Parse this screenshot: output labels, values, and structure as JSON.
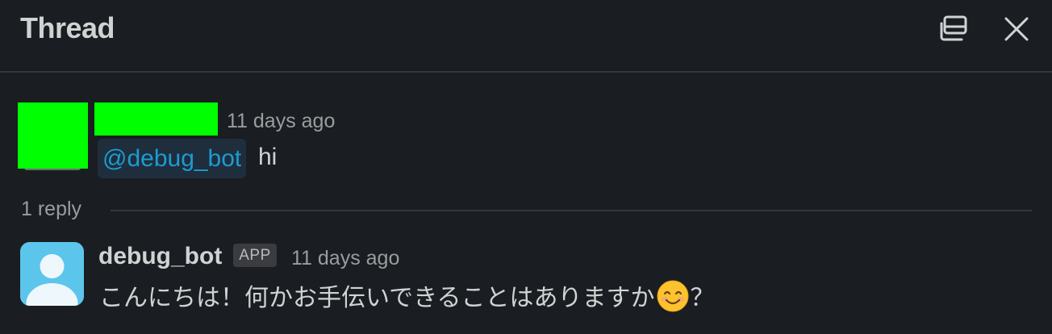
{
  "header": {
    "title": "Thread",
    "popout_icon": "popout-window-icon",
    "close_icon": "close-icon"
  },
  "parent_message": {
    "avatar": "redacted",
    "sender": "",
    "timestamp": "11 days ago",
    "mention": "@debug_bot",
    "text": "hi"
  },
  "replies": {
    "count_label": "1 reply"
  },
  "reply_message": {
    "avatar_icon": "default-user-avatar-icon",
    "sender": "debug_bot",
    "badge": "APP",
    "timestamp": "11 days ago",
    "text_before_emoji": "こんにちは！何かお手伝いできることはありますか",
    "emoji": "smiling-face-icon",
    "text_after_emoji": "？"
  },
  "colors": {
    "background": "#1a1d21",
    "text": "#d1d2d3",
    "muted": "#9b9c9e",
    "mention": "#1d9bd1",
    "mention_bg": "#1e2e3c",
    "redaction": "#00ff00",
    "bot_avatar": "#5cc5ec"
  }
}
